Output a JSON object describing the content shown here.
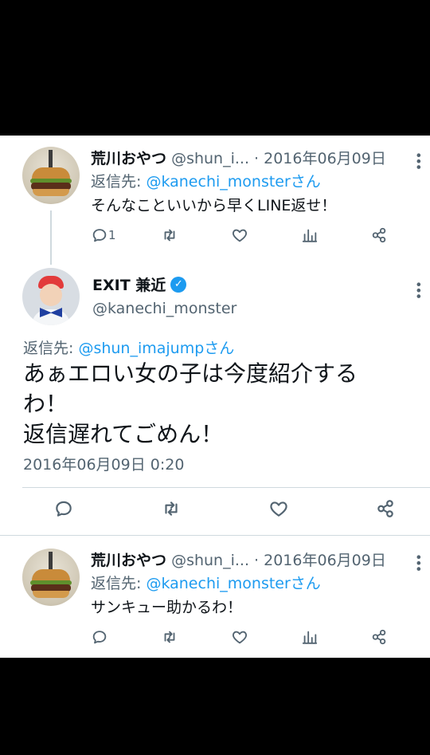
{
  "reply1": {
    "name": "荒川おやつ",
    "handle": "@shun_i...",
    "date": "· 2016年06月09日",
    "reply_to_prefix": "返信先:",
    "reply_to_handle": "@kanechi_monsterさん",
    "text": "そんなこといいから早くLINE返せ！",
    "reply_count": "1"
  },
  "main_tweet": {
    "name": "EXIT 兼近",
    "verified_mark": "✓",
    "handle": "@kanechi_monster",
    "reply_to_prefix": "返信先:",
    "reply_to_handle": "@shun_imajumpさん",
    "text_line1": "あぁエロい女の子は今度紹介する",
    "text_line2": "わ！",
    "text_line3": "返信遅れてごめん！",
    "timestamp": "2016年06月09日 0:20"
  },
  "reply2": {
    "name": "荒川おやつ",
    "handle": "@shun_i...",
    "date": "· 2016年06月09日",
    "reply_to_prefix": "返信先:",
    "reply_to_handle": "@kanechi_monsterさん",
    "text": "サンキュー助かるわ！"
  },
  "icons": [
    "reply-icon",
    "retweet-icon",
    "like-icon",
    "analytics-icon",
    "share-icon",
    "more-icon",
    "verified-icon"
  ],
  "colors": {
    "link": "#1d9bf0",
    "secondary": "#536471",
    "text": "#0f1419",
    "background": "#ffffff"
  }
}
